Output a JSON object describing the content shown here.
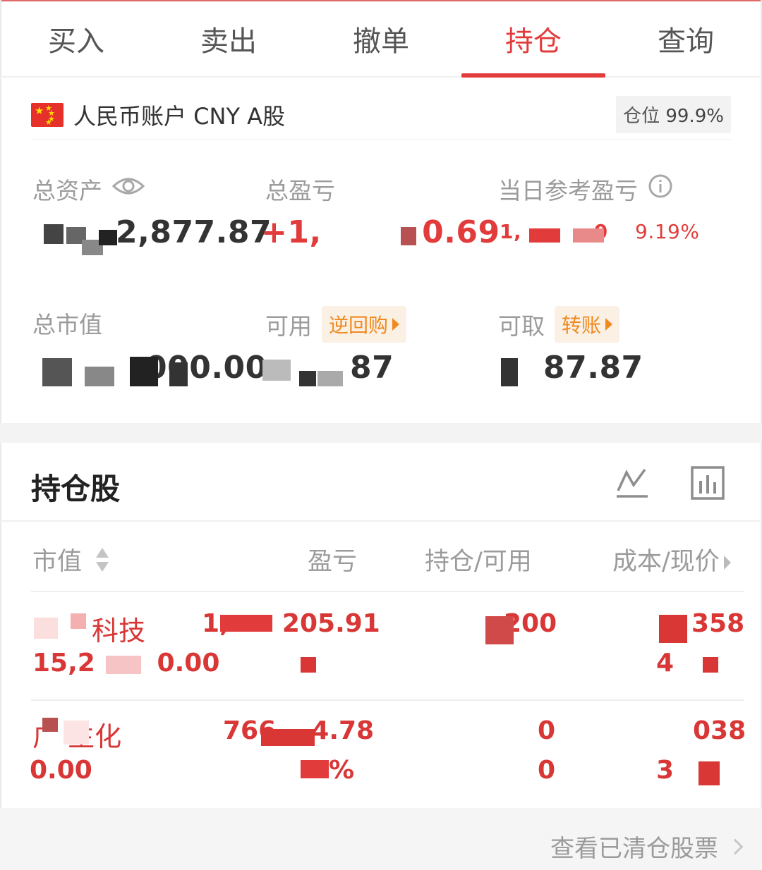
{
  "tabs": [
    {
      "label": "买入",
      "active": false
    },
    {
      "label": "卖出",
      "active": false
    },
    {
      "label": "撤单",
      "active": false
    },
    {
      "label": "持仓",
      "active": true
    },
    {
      "label": "查询",
      "active": false
    }
  ],
  "account": {
    "title": "人民币账户 CNY A股",
    "position_label": "仓位",
    "position_value": "99.9%"
  },
  "metrics": {
    "total_assets": {
      "label": "总资产",
      "value": "2,877.87"
    },
    "total_pnl": {
      "label": "总盈亏",
      "value": "+1,         0.69"
    },
    "daily_pnl": {
      "label": "当日参考盈亏",
      "value": "1,          0",
      "pct": "9.19%"
    },
    "market_value": {
      "label": "总市值",
      "value": "000.00"
    },
    "available": {
      "label": "可用",
      "chip": "逆回购",
      "value": "87"
    },
    "withdrawable": {
      "label": "可取",
      "chip": "转账",
      "value": "87.87"
    }
  },
  "holdings": {
    "title": "持仓股",
    "columns": {
      "market_value": "市值",
      "pnl": "盈亏",
      "position": "持仓/可用",
      "cost": "成本/现价"
    },
    "rows": [
      {
        "name": "科技",
        "market_value": "15,2       0.00",
        "pnl": "1,      205.91",
        "pnl_pct": "",
        "position": "200",
        "available": "",
        "cost": "358",
        "price": "4"
      },
      {
        "name": "广 生化",
        "market_value": "0.00",
        "pnl": "766    4.78",
        "pnl_pct": "%",
        "position": "0",
        "available": "0",
        "cost": "038",
        "price": "3"
      }
    ]
  },
  "footer": {
    "link": "查看已清仓股票"
  },
  "colors": {
    "accent": "#e23b3b",
    "chip": "#f08a20",
    "muted": "#9b9b9b"
  }
}
